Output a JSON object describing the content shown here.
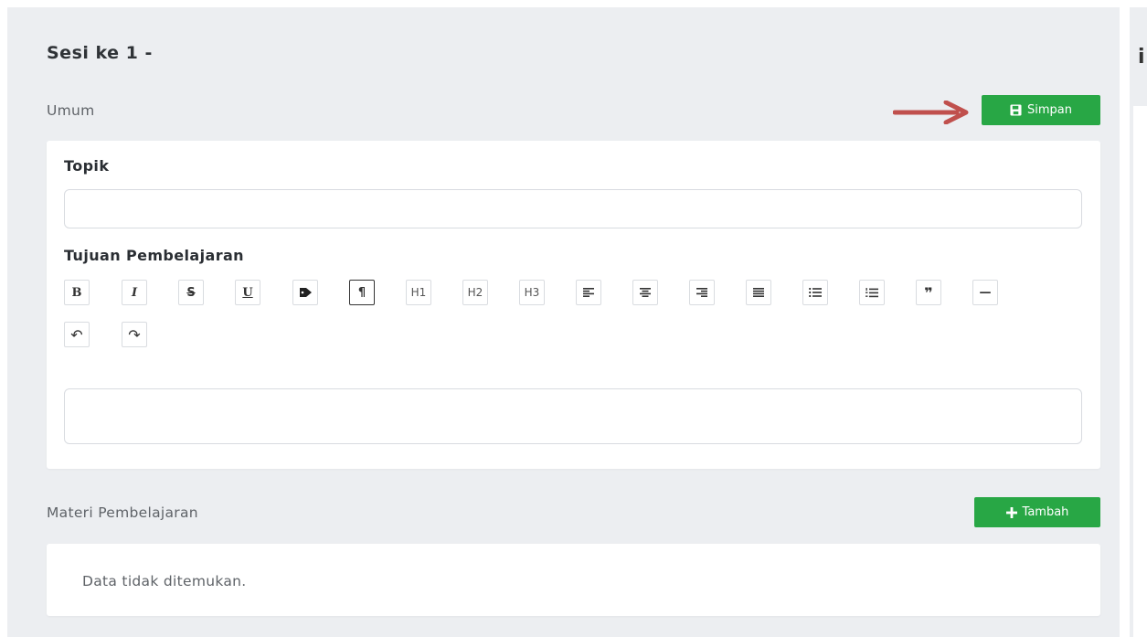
{
  "session": {
    "title": "Sesi ke 1 -"
  },
  "general": {
    "label": "Umum",
    "save_button": "Simpan",
    "save_icon": "floppy-disk-icon"
  },
  "annotation": {
    "arrow_color": "#c0504d",
    "arrow_icon": "red-arrow-pointer"
  },
  "form": {
    "topic_label": "Topik",
    "topic_value": "",
    "objective_label": "Tujuan Pembelajaran",
    "objective_value": ""
  },
  "toolbar": {
    "buttons": [
      {
        "name": "bold",
        "label": "B"
      },
      {
        "name": "italic",
        "label": "I"
      },
      {
        "name": "strikethrough",
        "label": "S"
      },
      {
        "name": "underline",
        "label": "U"
      },
      {
        "name": "tag",
        "label": ""
      },
      {
        "name": "paragraph",
        "label": "¶"
      },
      {
        "name": "h1",
        "label": "H1"
      },
      {
        "name": "h2",
        "label": "H2"
      },
      {
        "name": "h3",
        "label": "H3"
      },
      {
        "name": "align-left",
        "label": ""
      },
      {
        "name": "align-center",
        "label": ""
      },
      {
        "name": "align-right",
        "label": ""
      },
      {
        "name": "justify",
        "label": ""
      },
      {
        "name": "bullet-list",
        "label": ""
      },
      {
        "name": "ordered-list",
        "label": ""
      },
      {
        "name": "quote",
        "label": "❞"
      },
      {
        "name": "horizontal-rule",
        "label": "—"
      },
      {
        "name": "undo",
        "label": "↶"
      },
      {
        "name": "redo",
        "label": "↷"
      }
    ]
  },
  "materials": {
    "label": "Materi Pembelajaran",
    "add_button": "Tambah",
    "empty_text": "Data tidak ditemukan."
  },
  "colors": {
    "accent": "#28a745",
    "background": "#eceef1",
    "card": "#ffffff"
  }
}
